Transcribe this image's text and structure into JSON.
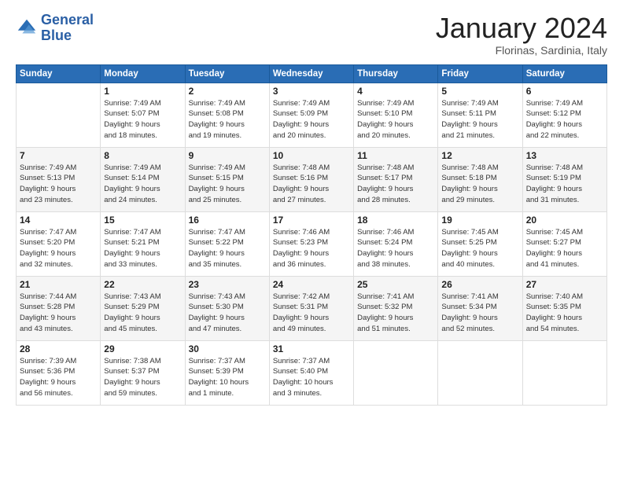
{
  "header": {
    "logo_line1": "General",
    "logo_line2": "Blue",
    "month": "January 2024",
    "location": "Florinas, Sardinia, Italy"
  },
  "days_of_week": [
    "Sunday",
    "Monday",
    "Tuesday",
    "Wednesday",
    "Thursday",
    "Friday",
    "Saturday"
  ],
  "weeks": [
    [
      {
        "day": "",
        "lines": []
      },
      {
        "day": "1",
        "lines": [
          "Sunrise: 7:49 AM",
          "Sunset: 5:07 PM",
          "Daylight: 9 hours",
          "and 18 minutes."
        ]
      },
      {
        "day": "2",
        "lines": [
          "Sunrise: 7:49 AM",
          "Sunset: 5:08 PM",
          "Daylight: 9 hours",
          "and 19 minutes."
        ]
      },
      {
        "day": "3",
        "lines": [
          "Sunrise: 7:49 AM",
          "Sunset: 5:09 PM",
          "Daylight: 9 hours",
          "and 20 minutes."
        ]
      },
      {
        "day": "4",
        "lines": [
          "Sunrise: 7:49 AM",
          "Sunset: 5:10 PM",
          "Daylight: 9 hours",
          "and 20 minutes."
        ]
      },
      {
        "day": "5",
        "lines": [
          "Sunrise: 7:49 AM",
          "Sunset: 5:11 PM",
          "Daylight: 9 hours",
          "and 21 minutes."
        ]
      },
      {
        "day": "6",
        "lines": [
          "Sunrise: 7:49 AM",
          "Sunset: 5:12 PM",
          "Daylight: 9 hours",
          "and 22 minutes."
        ]
      }
    ],
    [
      {
        "day": "7",
        "lines": [
          "Sunrise: 7:49 AM",
          "Sunset: 5:13 PM",
          "Daylight: 9 hours",
          "and 23 minutes."
        ]
      },
      {
        "day": "8",
        "lines": [
          "Sunrise: 7:49 AM",
          "Sunset: 5:14 PM",
          "Daylight: 9 hours",
          "and 24 minutes."
        ]
      },
      {
        "day": "9",
        "lines": [
          "Sunrise: 7:49 AM",
          "Sunset: 5:15 PM",
          "Daylight: 9 hours",
          "and 25 minutes."
        ]
      },
      {
        "day": "10",
        "lines": [
          "Sunrise: 7:48 AM",
          "Sunset: 5:16 PM",
          "Daylight: 9 hours",
          "and 27 minutes."
        ]
      },
      {
        "day": "11",
        "lines": [
          "Sunrise: 7:48 AM",
          "Sunset: 5:17 PM",
          "Daylight: 9 hours",
          "and 28 minutes."
        ]
      },
      {
        "day": "12",
        "lines": [
          "Sunrise: 7:48 AM",
          "Sunset: 5:18 PM",
          "Daylight: 9 hours",
          "and 29 minutes."
        ]
      },
      {
        "day": "13",
        "lines": [
          "Sunrise: 7:48 AM",
          "Sunset: 5:19 PM",
          "Daylight: 9 hours",
          "and 31 minutes."
        ]
      }
    ],
    [
      {
        "day": "14",
        "lines": [
          "Sunrise: 7:47 AM",
          "Sunset: 5:20 PM",
          "Daylight: 9 hours",
          "and 32 minutes."
        ]
      },
      {
        "day": "15",
        "lines": [
          "Sunrise: 7:47 AM",
          "Sunset: 5:21 PM",
          "Daylight: 9 hours",
          "and 33 minutes."
        ]
      },
      {
        "day": "16",
        "lines": [
          "Sunrise: 7:47 AM",
          "Sunset: 5:22 PM",
          "Daylight: 9 hours",
          "and 35 minutes."
        ]
      },
      {
        "day": "17",
        "lines": [
          "Sunrise: 7:46 AM",
          "Sunset: 5:23 PM",
          "Daylight: 9 hours",
          "and 36 minutes."
        ]
      },
      {
        "day": "18",
        "lines": [
          "Sunrise: 7:46 AM",
          "Sunset: 5:24 PM",
          "Daylight: 9 hours",
          "and 38 minutes."
        ]
      },
      {
        "day": "19",
        "lines": [
          "Sunrise: 7:45 AM",
          "Sunset: 5:25 PM",
          "Daylight: 9 hours",
          "and 40 minutes."
        ]
      },
      {
        "day": "20",
        "lines": [
          "Sunrise: 7:45 AM",
          "Sunset: 5:27 PM",
          "Daylight: 9 hours",
          "and 41 minutes."
        ]
      }
    ],
    [
      {
        "day": "21",
        "lines": [
          "Sunrise: 7:44 AM",
          "Sunset: 5:28 PM",
          "Daylight: 9 hours",
          "and 43 minutes."
        ]
      },
      {
        "day": "22",
        "lines": [
          "Sunrise: 7:43 AM",
          "Sunset: 5:29 PM",
          "Daylight: 9 hours",
          "and 45 minutes."
        ]
      },
      {
        "day": "23",
        "lines": [
          "Sunrise: 7:43 AM",
          "Sunset: 5:30 PM",
          "Daylight: 9 hours",
          "and 47 minutes."
        ]
      },
      {
        "day": "24",
        "lines": [
          "Sunrise: 7:42 AM",
          "Sunset: 5:31 PM",
          "Daylight: 9 hours",
          "and 49 minutes."
        ]
      },
      {
        "day": "25",
        "lines": [
          "Sunrise: 7:41 AM",
          "Sunset: 5:32 PM",
          "Daylight: 9 hours",
          "and 51 minutes."
        ]
      },
      {
        "day": "26",
        "lines": [
          "Sunrise: 7:41 AM",
          "Sunset: 5:34 PM",
          "Daylight: 9 hours",
          "and 52 minutes."
        ]
      },
      {
        "day": "27",
        "lines": [
          "Sunrise: 7:40 AM",
          "Sunset: 5:35 PM",
          "Daylight: 9 hours",
          "and 54 minutes."
        ]
      }
    ],
    [
      {
        "day": "28",
        "lines": [
          "Sunrise: 7:39 AM",
          "Sunset: 5:36 PM",
          "Daylight: 9 hours",
          "and 56 minutes."
        ]
      },
      {
        "day": "29",
        "lines": [
          "Sunrise: 7:38 AM",
          "Sunset: 5:37 PM",
          "Daylight: 9 hours",
          "and 59 minutes."
        ]
      },
      {
        "day": "30",
        "lines": [
          "Sunrise: 7:37 AM",
          "Sunset: 5:39 PM",
          "Daylight: 10 hours",
          "and 1 minute."
        ]
      },
      {
        "day": "31",
        "lines": [
          "Sunrise: 7:37 AM",
          "Sunset: 5:40 PM",
          "Daylight: 10 hours",
          "and 3 minutes."
        ]
      },
      {
        "day": "",
        "lines": []
      },
      {
        "day": "",
        "lines": []
      },
      {
        "day": "",
        "lines": []
      }
    ]
  ]
}
